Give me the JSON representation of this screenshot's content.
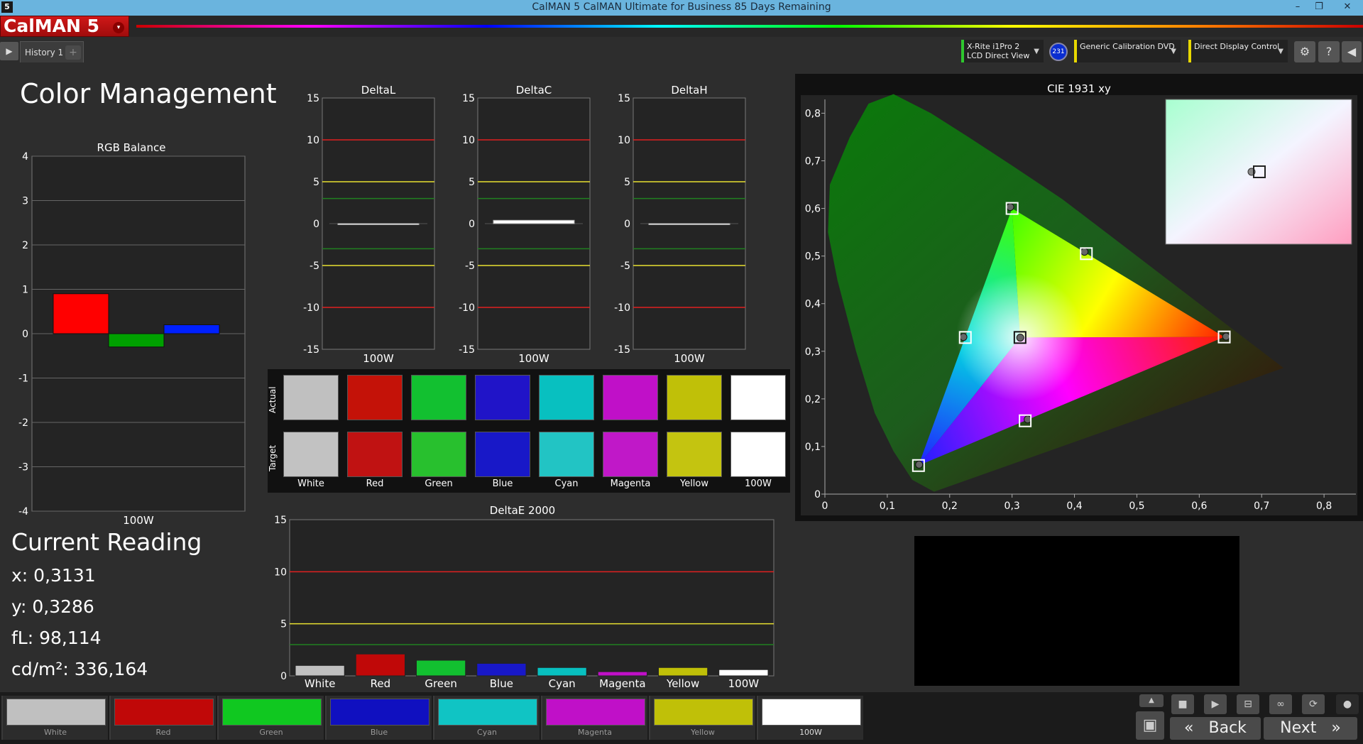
{
  "window": {
    "title": "CalMAN 5 CalMAN Ultimate for Business 85 Days Remaining",
    "app_icon": "5",
    "minimize": "–",
    "restore": "❐",
    "close": "✕"
  },
  "logo": {
    "text": "CalMAN 5",
    "dropdown": "▾"
  },
  "tabs": [
    {
      "label": "History 1"
    }
  ],
  "tab_add": "+",
  "devices": [
    {
      "line1": "X-Rite i1Pro 2",
      "line2": "LCD Direct View",
      "color": "#2ec82e"
    },
    {
      "line1": "Generic Calibration DVD",
      "line2": "",
      "color": "#e8d800"
    },
    {
      "line1": "Direct Display Control",
      "line2": "",
      "color": "#e8d800"
    }
  ],
  "meter_badge": "231",
  "page_title": "Color Management",
  "rgb_balance": {
    "title": "RGB Balance",
    "xlabel": "100W",
    "ylim": [
      -4,
      4
    ],
    "yticks": [
      "4",
      "3",
      "2",
      "1",
      "0",
      "-1",
      "-2",
      "-3",
      "-4"
    ]
  },
  "delta_charts": [
    {
      "title": "DeltaL",
      "xlabel": "100W"
    },
    {
      "title": "DeltaC",
      "xlabel": "100W"
    },
    {
      "title": "DeltaH",
      "xlabel": "100W"
    }
  ],
  "delta_yticks": [
    "15",
    "10",
    "5",
    "0",
    "-5",
    "-10",
    "-15"
  ],
  "swatches": {
    "actual_label": "Actual",
    "target_label": "Target",
    "items": [
      {
        "name": "White",
        "actual": "#c0c0c0",
        "target": "#c2c2c2"
      },
      {
        "name": "Red",
        "actual": "#c41208",
        "target": "#c01212"
      },
      {
        "name": "Green",
        "actual": "#12c030",
        "target": "#28c02e"
      },
      {
        "name": "Blue",
        "actual": "#2014c8",
        "target": "#1818c8"
      },
      {
        "name": "Cyan",
        "actual": "#08c0c0",
        "target": "#22c4c4"
      },
      {
        "name": "Magenta",
        "actual": "#c010c8",
        "target": "#c018c8"
      },
      {
        "name": "Yellow",
        "actual": "#c0c008",
        "target": "#c4c410"
      },
      {
        "name": "100W",
        "actual": "#ffffff",
        "target": "#ffffff"
      }
    ]
  },
  "deltae": {
    "title": "DeltaE 2000",
    "yticks": [
      "15",
      "10",
      "5",
      "0"
    ]
  },
  "cie": {
    "title": "CIE 1931 xy",
    "xticks": [
      "0",
      "0,1",
      "0,2",
      "0,3",
      "0,4",
      "0,5",
      "0,6",
      "0,7",
      "0,8"
    ],
    "yticks": [
      "0",
      "0,1",
      "0,2",
      "0,3",
      "0,4",
      "0,5",
      "0,6",
      "0,7",
      "0,8"
    ]
  },
  "current_reading": {
    "heading": "Current Reading",
    "x": "x: 0,3131",
    "y": "y: 0,3286",
    "fl": "fL: 98,114",
    "cdm2": "cd/m²: 336,164"
  },
  "bottom_swatches": [
    {
      "label": "White",
      "color": "#c0c0c0"
    },
    {
      "label": "Red",
      "color": "#c00808"
    },
    {
      "label": "Green",
      "color": "#10c820"
    },
    {
      "label": "Blue",
      "color": "#1010c0"
    },
    {
      "label": "Cyan",
      "color": "#10c4c4"
    },
    {
      "label": "Magenta",
      "color": "#c010c8"
    },
    {
      "label": "Yellow",
      "color": "#c0c008"
    },
    {
      "label": "100W",
      "color": "#ffffff"
    }
  ],
  "nav": {
    "back": "Back",
    "next": "Next",
    "back_icon": "«",
    "next_icon": "»"
  },
  "chart_data": [
    {
      "type": "bar",
      "title": "RGB Balance",
      "categories": [
        "100W"
      ],
      "series": [
        {
          "values": [
            0.9
          ]
        },
        {
          "values": [
            -0.3
          ]
        },
        {
          "values": [
            0.2
          ]
        }
      ],
      "colors": [
        "#ff0000",
        "#00a000",
        "#0020ff"
      ],
      "ylim": [
        -4,
        4
      ],
      "grid": true
    },
    {
      "type": "bar",
      "title": "DeltaL",
      "categories": [
        "100W"
      ],
      "values": [
        0.0
      ],
      "ylim": [
        -15,
        15
      ]
    },
    {
      "type": "bar",
      "title": "DeltaC",
      "categories": [
        "100W"
      ],
      "values": [
        0.4
      ],
      "ylim": [
        -15,
        15
      ]
    },
    {
      "type": "bar",
      "title": "DeltaH",
      "categories": [
        "100W"
      ],
      "values": [
        0.0
      ],
      "ylim": [
        -15,
        15
      ]
    },
    {
      "type": "bar",
      "title": "DeltaE 2000",
      "categories": [
        "White",
        "Red",
        "Green",
        "Blue",
        "Cyan",
        "Magenta",
        "Yellow",
        "100W"
      ],
      "values": [
        1.0,
        2.1,
        1.5,
        1.2,
        0.8,
        0.4,
        0.8,
        0.6
      ],
      "colors": [
        "#c0c0c0",
        "#c00808",
        "#12c030",
        "#1818c8",
        "#08c0c0",
        "#c010c8",
        "#c0c008",
        "#ffffff"
      ],
      "ylim": [
        0,
        15
      ]
    },
    {
      "type": "scatter",
      "title": "CIE 1931 xy",
      "xlim": [
        0,
        0.8
      ],
      "ylim": [
        0,
        0.8
      ],
      "targets": [
        {
          "name": "Red",
          "x": 0.64,
          "y": 0.33
        },
        {
          "name": "Green",
          "x": 0.3,
          "y": 0.6
        },
        {
          "name": "Blue",
          "x": 0.15,
          "y": 0.06
        },
        {
          "name": "Cyan",
          "x": 0.225,
          "y": 0.329
        },
        {
          "name": "Magenta",
          "x": 0.321,
          "y": 0.154
        },
        {
          "name": "Yellow",
          "x": 0.419,
          "y": 0.505
        },
        {
          "name": "White",
          "x": 0.3127,
          "y": 0.329
        }
      ],
      "actuals": [
        {
          "name": "Red",
          "x": 0.643,
          "y": 0.331
        },
        {
          "name": "Green",
          "x": 0.297,
          "y": 0.603
        },
        {
          "name": "Blue",
          "x": 0.151,
          "y": 0.062
        },
        {
          "name": "Cyan",
          "x": 0.222,
          "y": 0.33
        },
        {
          "name": "Magenta",
          "x": 0.325,
          "y": 0.157
        },
        {
          "name": "Yellow",
          "x": 0.416,
          "y": 0.509
        },
        {
          "name": "White",
          "x": 0.3131,
          "y": 0.3286
        }
      ]
    }
  ]
}
